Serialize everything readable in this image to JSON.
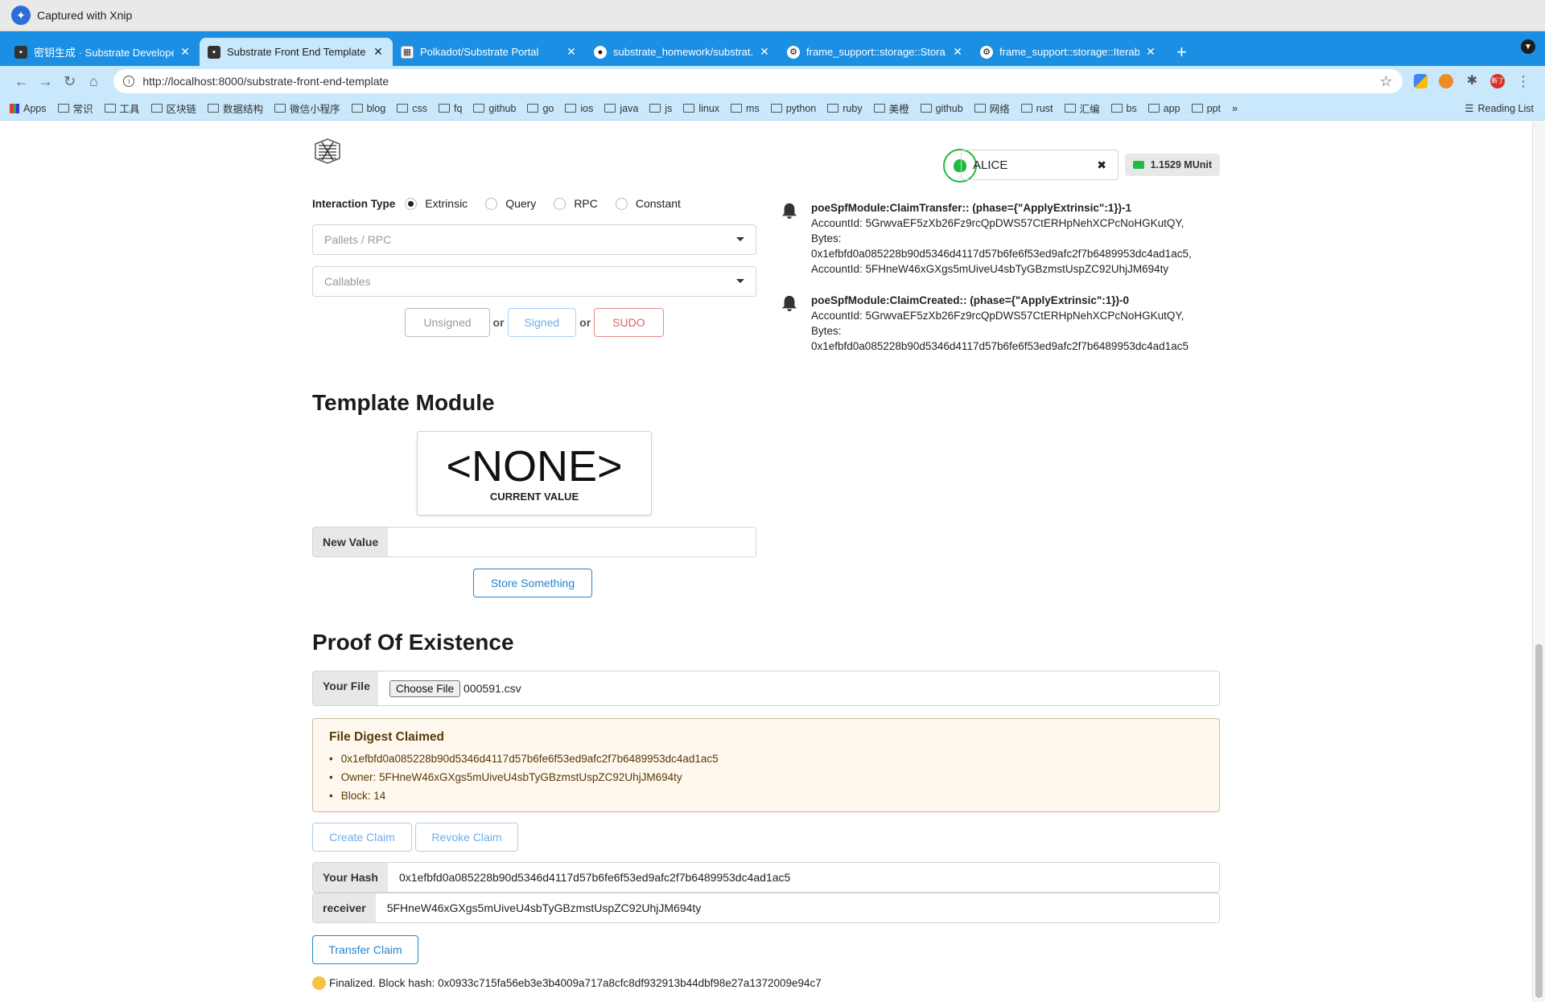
{
  "xnip": {
    "title": "Captured with Xnip"
  },
  "browser": {
    "tabs": [
      {
        "label": "密钥生成 · Substrate Developer..."
      },
      {
        "label": "Substrate Front End Template"
      },
      {
        "label": "Polkadot/Substrate Portal"
      },
      {
        "label": "substrate_homework/substrat..."
      },
      {
        "label": "frame_support::storage::Stora..."
      },
      {
        "label": "frame_support::storage::Iterab..."
      }
    ],
    "url": "http://localhost:8000/substrate-front-end-template",
    "bookmarks": [
      "常识",
      "工具",
      "区块链",
      "数据结构",
      "微信小程序",
      "blog",
      "css",
      "fq",
      "github",
      "go",
      "ios",
      "java",
      "js",
      "linux",
      "ms",
      "python",
      "ruby",
      "美橙",
      "github",
      "网络",
      "rust",
      "汇编",
      "bs",
      "app",
      "ppt"
    ],
    "apps_label": "Apps",
    "reading_list": "Reading List",
    "ext_profile": "断了"
  },
  "header": {
    "account": "ALICE",
    "balance": "1.1529 MUnit"
  },
  "interactor": {
    "label": "Interaction Type",
    "types": [
      "Extrinsic",
      "Query",
      "RPC",
      "Constant"
    ],
    "pallets_placeholder": "Pallets / RPC",
    "callables_placeholder": "Callables",
    "unsigned": "Unsigned",
    "signed": "Signed",
    "sudo": "SUDO",
    "or": "or"
  },
  "events": [
    {
      "title": "poeSpfModule:ClaimTransfer:: (phase={\"ApplyExtrinsic\":1})-1",
      "lines": [
        "AccountId: 5GrwvaEF5zXb26Fz9rcQpDWS57CtERHpNehXCPcNoHGKutQY,",
        "Bytes:",
        "0x1efbfd0a085228b90d5346d4117d57b6fe6f53ed9afc2f7b6489953dc4ad1ac5,",
        "AccountId: 5FHneW46xGXgs5mUiveU4sbTyGBzmstUspZC92UhjJM694ty"
      ]
    },
    {
      "title": "poeSpfModule:ClaimCreated:: (phase={\"ApplyExtrinsic\":1})-0",
      "lines": [
        "AccountId: 5GrwvaEF5zXb26Fz9rcQpDWS57CtERHpNehXCPcNoHGKutQY,",
        "Bytes:",
        "0x1efbfd0a085228b90d5346d4117d57b6fe6f53ed9afc2f7b6489953dc4ad1ac5"
      ]
    }
  ],
  "template": {
    "title": "Template Module",
    "value": "<NONE>",
    "caption": "CURRENT VALUE",
    "new_value_label": "New Value",
    "new_value": "",
    "store_button": "Store Something"
  },
  "poe": {
    "title": "Proof Of Existence",
    "file_label": "Your File",
    "choose_file": "Choose File",
    "file_name": "000591.csv",
    "claimed_title": "File Digest Claimed",
    "claimed_items": [
      "0x1efbfd0a085228b90d5346d4117d57b6fe6f53ed9afc2f7b6489953dc4ad1ac5",
      "Owner: 5FHneW46xGXgs5mUiveU4sbTyGBzmstUspZC92UhjJM694ty",
      "Block: 14"
    ],
    "create_claim": "Create Claim",
    "revoke_claim": "Revoke Claim",
    "hash_label": "Your Hash",
    "hash_value": "0x1efbfd0a085228b90d5346d4117d57b6fe6f53ed9afc2f7b6489953dc4ad1ac5",
    "receiver_label": "receiver",
    "receiver_value": "5FHneW46xGXgs5mUiveU4sbTyGBzmstUspZC92UhjJM694ty",
    "transfer_button": "Transfer Claim",
    "status": "Finalized. Block hash: 0x0933c715fa56eb3e3b4009a717a8cfc8df932913b44dbf98e27a1372009e94c7"
  }
}
